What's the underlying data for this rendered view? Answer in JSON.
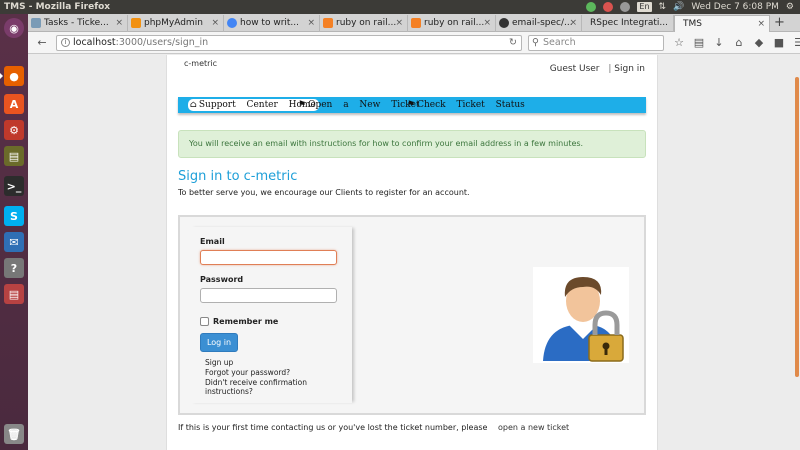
{
  "os": {
    "window_title": "TMS - Mozilla Firefox",
    "tray": {
      "lang": "En",
      "datetime": "Wed Dec 7  6:08 PM"
    }
  },
  "tabs": [
    {
      "label": "Tasks - Ticke...",
      "color": "#7a9bb6"
    },
    {
      "label": "phpMyAdmin",
      "color": "#f29111"
    },
    {
      "label": "how to writ...",
      "color": "#4285f4"
    },
    {
      "label": "ruby on rail...",
      "color": "#f48024"
    },
    {
      "label": "ruby on rail...",
      "color": "#f48024"
    },
    {
      "label": "email-spec/...",
      "color": "#333333"
    },
    {
      "label": "RSpec Integrati...",
      "color": "#cfcfcf"
    },
    {
      "label": "TMS",
      "color": "#ffffff"
    }
  ],
  "navbar": {
    "url_host": "localhost",
    "url_path": ":3000/users/sign_in",
    "search_placeholder": "Search"
  },
  "page": {
    "brand": "c-metric",
    "guest": "Guest User",
    "separator": "|",
    "sign_in_link": "Sign in",
    "nav": {
      "support_home": "Support Center Home",
      "open_ticket": "Open a New Ticket",
      "check_status": "Check Ticket Status"
    },
    "alert": "You will receive an email with instructions for how to confirm your email address in a few minutes.",
    "heading": "Sign in to c-metric",
    "intro": "To better serve you, we encourage our Clients to register for an account.",
    "form": {
      "email_label": "Email",
      "email_value": "",
      "password_label": "Password",
      "password_value": "",
      "remember_label": "Remember me",
      "submit": "Log in",
      "links": [
        "Sign up",
        "Forgot your password?",
        "Didn't receive confirmation instructions?"
      ]
    },
    "footer_text": "If this is your first time contacting us or you've lost the ticket number, please",
    "footer_link": "open a new ticket"
  },
  "colors": {
    "accent_blue": "#1eaee8",
    "heading_blue": "#1e9fd8",
    "alert_bg": "#dff0d8",
    "alert_text": "#3c763d",
    "button_blue": "#3b8fd3"
  }
}
